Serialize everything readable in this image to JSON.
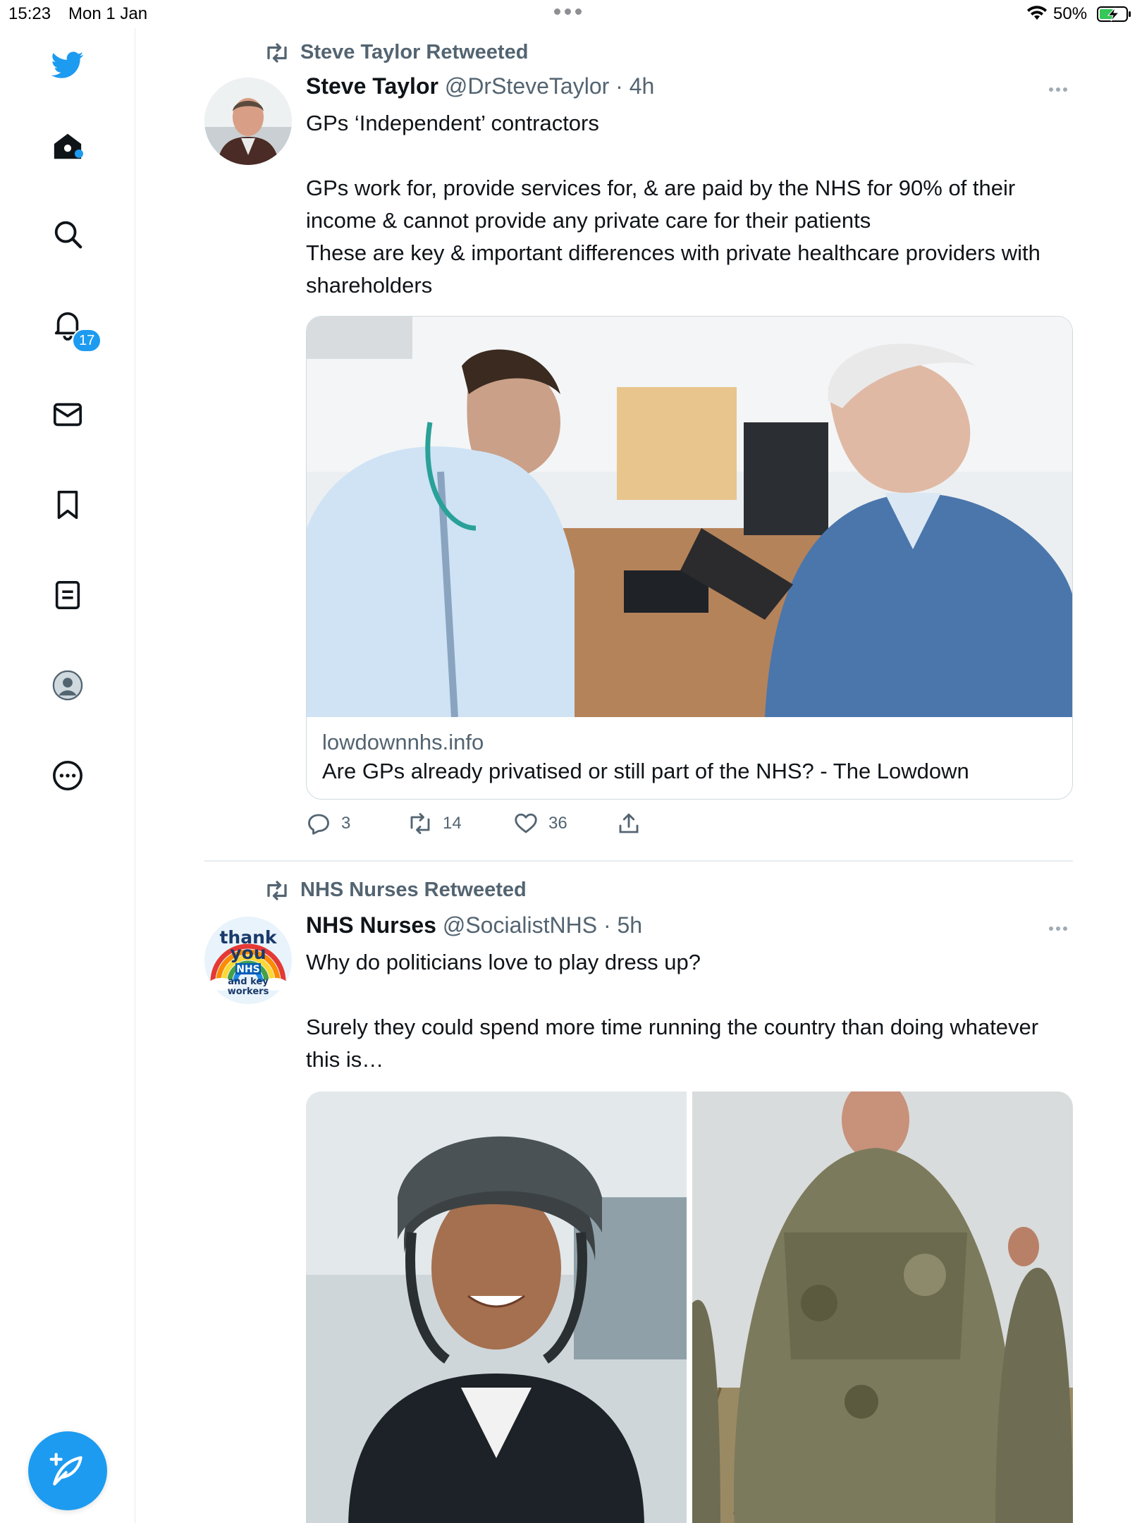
{
  "status_bar": {
    "time": "15:23",
    "date": "Mon 1 Jan",
    "battery": "50%"
  },
  "sidebar": {
    "items": [
      {
        "name": "twitter-logo-icon"
      },
      {
        "name": "home-icon"
      },
      {
        "name": "search-icon"
      },
      {
        "name": "notifications-icon"
      },
      {
        "name": "messages-icon"
      },
      {
        "name": "bookmarks-icon"
      },
      {
        "name": "lists-icon"
      },
      {
        "name": "profile-icon"
      },
      {
        "name": "more-icon"
      }
    ],
    "notifications_badge": "17",
    "compose_icon": "compose-tweet-icon"
  },
  "colors": {
    "accent": "#1d9bf0",
    "secondary_text": "#536471",
    "primary_text": "#0f1419",
    "border": "#cfd9de"
  },
  "feed": {
    "tweets": [
      {
        "retweeted_by": "Steve Taylor Retweeted",
        "name": "Steve Taylor",
        "handle": "@DrSteveTaylor",
        "time": "· 4h",
        "text": [
          "GPs ‘Independent’ contractors",
          "",
          "GPs work for, provide services for, & are paid by the NHS for 90% of their income & cannot provide any private care for their patients",
          "These are key & important differences with private healthcare providers with shareholders"
        ],
        "card": {
          "domain": "lowdownnhs.info",
          "title": "Are GPs already privatised or still part of the NHS? - The Lowdown"
        },
        "stats": {
          "replies": "3",
          "retweets": "14",
          "likes": "36"
        }
      },
      {
        "retweeted_by": "NHS Nurses Retweeted",
        "name": "NHS Nurses",
        "handle": "@SocialistNHS",
        "time": "· 5h",
        "avatar_lines": [
          "thank",
          "you",
          "NHS",
          "and key",
          "workers"
        ],
        "text": [
          "Why do politicians love to play dress up?",
          "",
          "Surely they could spend more time running the country than doing whatever this is…"
        ]
      }
    ]
  }
}
